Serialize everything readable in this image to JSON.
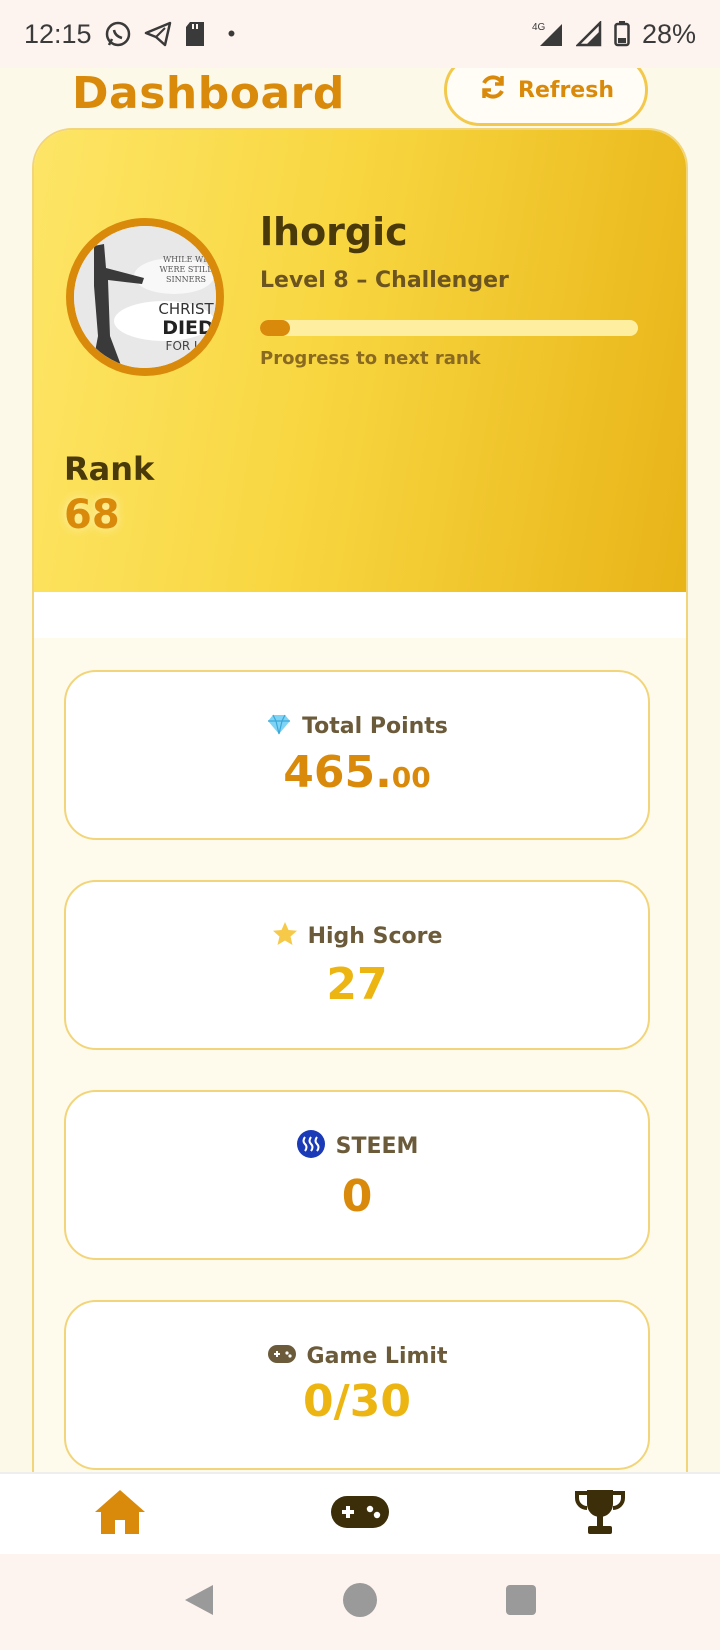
{
  "status_bar": {
    "time": "12:15",
    "network": "4G",
    "battery": "28%",
    "icons": [
      "whatsapp-icon",
      "telegram-icon",
      "sd-card-icon",
      "signal-icon",
      "battery-icon"
    ]
  },
  "header": {
    "title": "Dashboard",
    "refresh_label": "Refresh"
  },
  "profile": {
    "username": "lhorgic",
    "level": "Level 8 – Challenger",
    "progress_label": "Progress to next rank",
    "progress_fraction": 0.08,
    "avatar_text": [
      "WHILE WE",
      "WERE STILL",
      "SINNERS",
      "CHRIST",
      "DIED",
      "FOR US"
    ]
  },
  "rank": {
    "label": "Rank",
    "value": "68"
  },
  "stats": [
    {
      "label": "Total Points",
      "value_int": "465.",
      "value_dec": "00",
      "icon": "gem-icon"
    },
    {
      "label": "High Score",
      "value": "27",
      "icon": "star-icon"
    },
    {
      "label": "STEEM",
      "value": "0",
      "icon": "steem-icon"
    },
    {
      "label": "Game Limit",
      "value": "0/30",
      "icon": "gamepad-icon"
    }
  ],
  "bottom_nav": [
    "home-icon",
    "gamepad-icon",
    "trophy-icon"
  ],
  "colors": {
    "accent": "#d98a0a",
    "gold": "#ecb512",
    "hero_start": "#fde566",
    "hero_end": "#e8b418"
  }
}
